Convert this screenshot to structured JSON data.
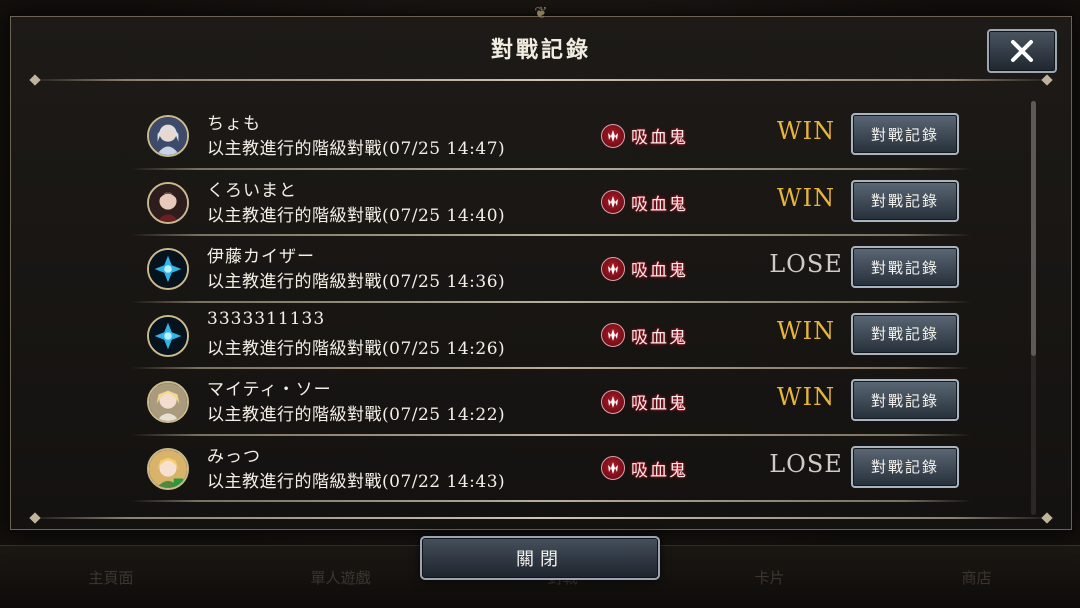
{
  "dialog": {
    "title": "對戰記錄",
    "close_label": "關閉"
  },
  "class_icon": "vampire-emblem-icon",
  "matches": [
    {
      "name": "ちょも",
      "desc": "以主教進行的階級對戰(07/25 14:47)",
      "class": "吸血鬼",
      "result": "WIN",
      "button": "對戰記錄",
      "avatar": "silver-hair-portrait"
    },
    {
      "name": "くろいまと",
      "desc": "以主教進行的階級對戰(07/25 14:40)",
      "class": "吸血鬼",
      "result": "WIN",
      "button": "對戰記錄",
      "avatar": "dark-hair-portrait"
    },
    {
      "name": "伊藤カイザー",
      "desc": "以主教進行的階級對戰(07/25 14:36)",
      "class": "吸血鬼",
      "result": "LOSE",
      "button": "對戰記錄",
      "avatar": "blue-emblem"
    },
    {
      "name": "3333311133",
      "desc": "以主教進行的階級對戰(07/25 14:26)",
      "class": "吸血鬼",
      "result": "WIN",
      "button": "對戰記錄",
      "avatar": "blue-emblem"
    },
    {
      "name": "マイティ・ソー",
      "desc": "以主教進行的階級對戰(07/25 14:22)",
      "class": "吸血鬼",
      "result": "WIN",
      "button": "對戰記錄",
      "avatar": "blonde-portrait"
    },
    {
      "name": "みっつ",
      "desc": "以主教進行的階級對戰(07/22 14:43)",
      "class": "吸血鬼",
      "result": "LOSE",
      "button": "對戰記錄",
      "avatar": "elf-portrait"
    }
  ],
  "background_nav": [
    "主頁面",
    "單人遊戲",
    "對戰",
    "卡片",
    "商店"
  ]
}
